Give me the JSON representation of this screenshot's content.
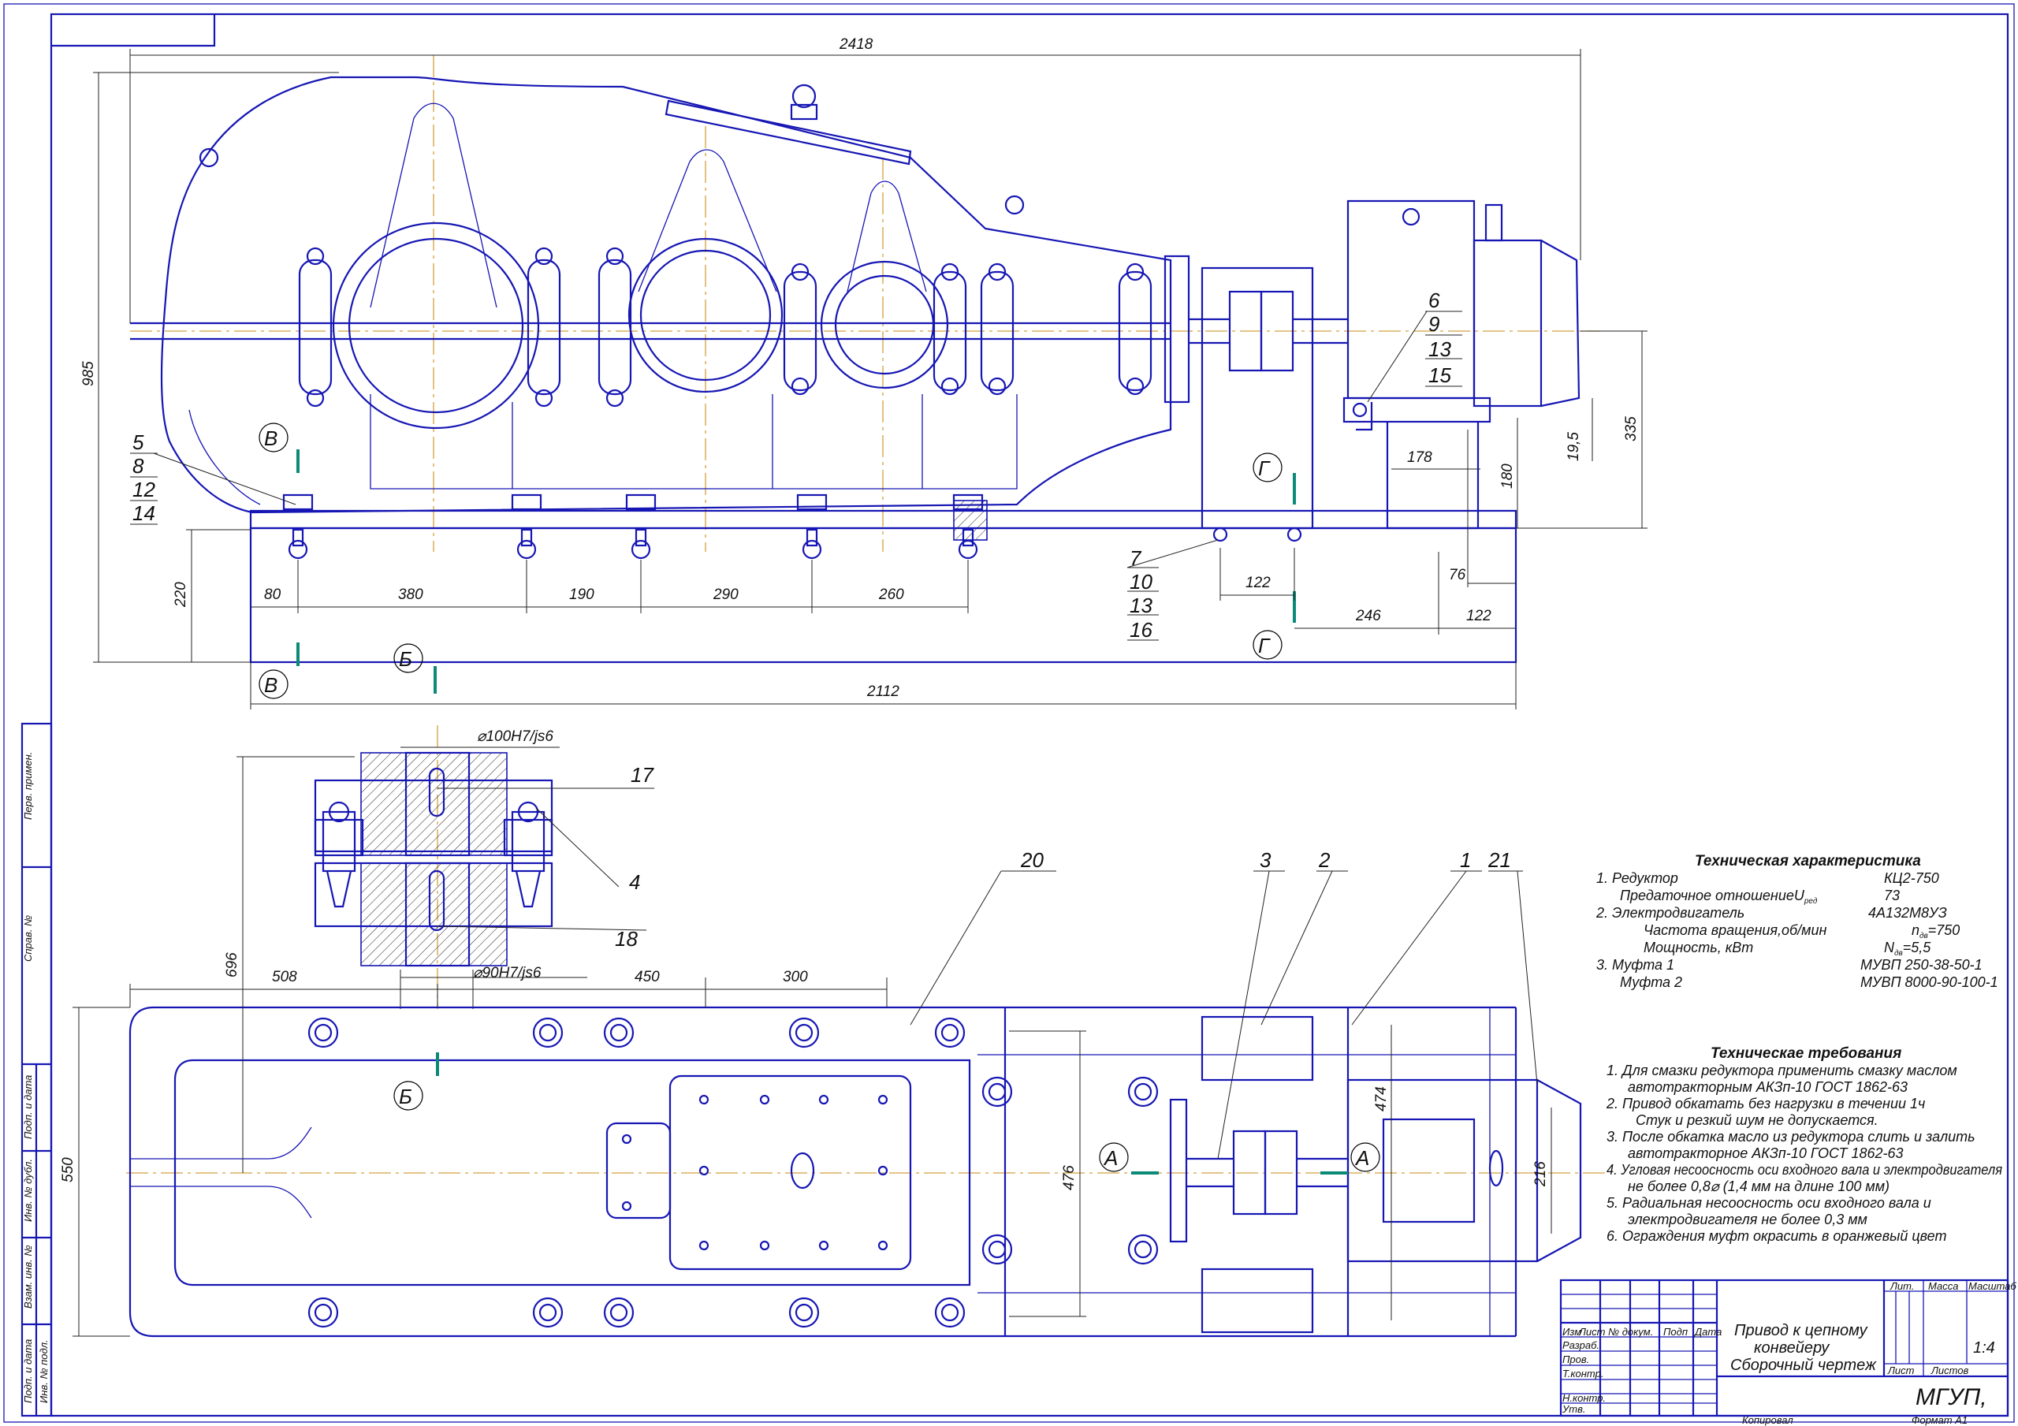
{
  "dimensions": {
    "total_length": "2418",
    "total_height": "985",
    "frame_height": "220",
    "bolt_spacing": [
      "80",
      "380",
      "190",
      "290",
      "260"
    ],
    "frame_length": "2112",
    "motor_frame": [
      "122",
      "246",
      "122",
      "76"
    ],
    "motor_height": "180",
    "motor_width": "178",
    "shaft_height": "335",
    "shim": "19,5",
    "plan_width": "550",
    "plan_shaft_height": "696",
    "plan_offsets": [
      "508",
      "450",
      "300"
    ],
    "plan_frame_width": "476",
    "plan_motor_width": "474",
    "plan_motor_depth": "216",
    "fit_top": "⌀100H7/js6",
    "fit_bottom": "⌀90H7/js6"
  },
  "sections": {
    "v": "В",
    "b": "Б",
    "g": "Г",
    "a": "А"
  },
  "positions": {
    "left_stack": [
      "5",
      "8",
      "12",
      "14"
    ],
    "motor_stack": [
      "6",
      "9",
      "13",
      "15"
    ],
    "frame_stack": [
      "7",
      "10",
      "13",
      "16"
    ],
    "section_17": "17",
    "section_4": "4",
    "section_18": "18",
    "plan_20": "20",
    "plan_3": "3",
    "plan_2": "2",
    "plan_1": "1",
    "plan_21": "21"
  },
  "tech_spec": {
    "title": "Техническая характеристика",
    "rows": [
      {
        "label": "1. Редуктор",
        "value": "КЦ2-750"
      },
      {
        "label": "Предаточное отношениеU",
        "sub": "ред",
        "value": "73"
      },
      {
        "label": "2. Электродвигатель",
        "value": "4А132М8УЗ"
      },
      {
        "label": "Частота вращения,об/мин",
        "value": "=750",
        "vsym": "n",
        "vsub": "дв"
      },
      {
        "label": "Мощность, кВт",
        "value": "=5,5",
        "vsym": "N",
        "vsub": "дв"
      },
      {
        "label": "3.   Муфта 1",
        "value": "МУВП 250-38-50-1"
      },
      {
        "label": "Муфта 2",
        "value": "МУВП 8000-90-100-1"
      }
    ]
  },
  "tech_req": {
    "title": "Техническае требования",
    "lines": [
      "1. Для смазки редуктора применить смазку маслом",
      "автотракторным                АКЗп-10 ГОСТ 1862-63",
      "2. Привод обкатать без нагрузки в течении  1ч",
      "Стук и резкий шум не допускается.",
      "3. После обкатка масло из редуктора слить и залить",
      "автотракторное                АКЗп-10 ГОСТ 1862-63",
      "4. Угловая несоосность оси входного вала и электродвигателя",
      "не более 0,8⌀ (1,4 мм на длине 100 мм)",
      "5. Радиальная несоосность оси входного вала и",
      "электродвигателя не более 0,3 мм",
      "6. Ограждения муфт окрасить в оранжевый цвет"
    ]
  },
  "title_block": {
    "name_line1": "Привод к цепному",
    "name_line2": "конвейеру",
    "name_line3": "Сборочный чертеж",
    "col_izm": "Изм",
    "col_list": "Лист",
    "col_doc": "№ докум.",
    "col_podp": "Подп",
    "col_data": "Дата",
    "row_razrab": "Разраб.",
    "row_prov": "Пров.",
    "row_tkontr": "Т.контр.",
    "row_nkontr": "Н.контр.",
    "row_utv": "Утв.",
    "hdr_lit": "Лит.",
    "hdr_massa": "Масса",
    "hdr_masshtab": "Масштаб",
    "scale": "1:4",
    "sheet": "Лист",
    "sheets": "Листов",
    "org": "МГУП,",
    "copied": "Копировал",
    "format": "Формат  А1"
  },
  "side_stamp": {
    "perv": "Перв. примен.",
    "sprav": "Справ. №",
    "podp1": "Подп. и дата",
    "inv_dubl": "Инв. № дубл.",
    "vzam": "Взам. инв. №",
    "podp2": "Подп. и дата",
    "inv_podl": "Инв. № подл."
  }
}
